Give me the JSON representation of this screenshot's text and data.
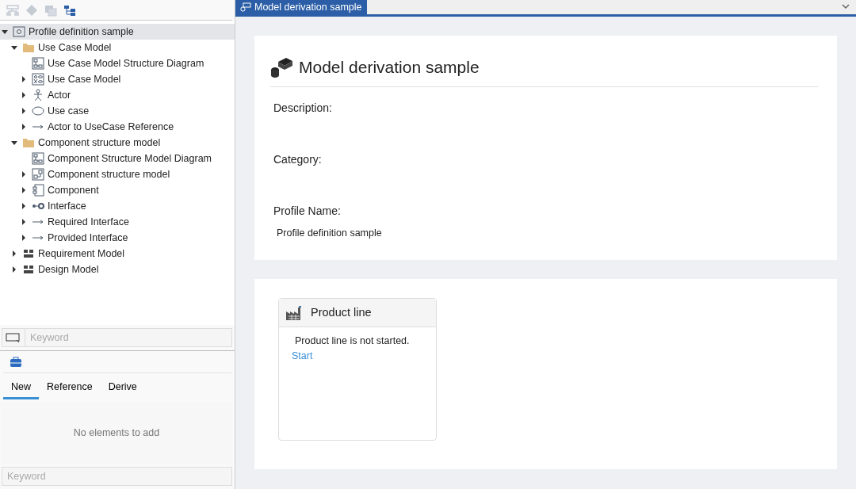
{
  "tree": [
    {
      "label": "Profile definition sample",
      "kind": "profile",
      "expanded": true,
      "selected": true,
      "children": [
        {
          "label": "Use Case Model",
          "kind": "folder",
          "expanded": true,
          "selected": false,
          "children": [
            {
              "label": "Use Case Model Structure Diagram",
              "kind": "diagram",
              "selected": false
            },
            {
              "label": "Use Case Model",
              "kind": "usecase-model",
              "expanded": false,
              "selected": false
            },
            {
              "label": "Actor",
              "kind": "actor",
              "expanded": false,
              "selected": false
            },
            {
              "label": "Use case",
              "kind": "ellipse",
              "expanded": false,
              "selected": false
            },
            {
              "label": "Actor to UseCase Reference",
              "kind": "arrow",
              "expanded": false,
              "selected": false
            }
          ]
        },
        {
          "label": "Component structure model",
          "kind": "folder",
          "expanded": true,
          "selected": false,
          "children": [
            {
              "label": "Component Structure Model Diagram",
              "kind": "diagram",
              "selected": false
            },
            {
              "label": "Component structure model",
              "kind": "component-model",
              "expanded": false,
              "selected": false
            },
            {
              "label": "Component",
              "kind": "component",
              "expanded": false,
              "selected": false
            },
            {
              "label": "Interface",
              "kind": "interface",
              "expanded": false,
              "selected": false
            },
            {
              "label": "Required Interface",
              "kind": "arrow",
              "expanded": false,
              "selected": false
            },
            {
              "label": "Provided Interface",
              "kind": "arrow",
              "expanded": false,
              "selected": false
            }
          ]
        },
        {
          "label": "Requirement Model",
          "kind": "package",
          "expanded": false,
          "selected": false
        },
        {
          "label": "Design Model",
          "kind": "package",
          "expanded": false,
          "selected": false
        }
      ]
    }
  ],
  "tree_search": {
    "placeholder": "Keyword"
  },
  "toolbox": {
    "tabs": [
      {
        "label": "New",
        "selected": true
      },
      {
        "label": "Reference",
        "selected": false
      },
      {
        "label": "Derive",
        "selected": false
      }
    ],
    "empty_text": "No elements to add",
    "search": {
      "placeholder": "Keyword"
    }
  },
  "editor_tab": {
    "label": "Model derivation sample"
  },
  "header": {
    "title": "Model derivation sample"
  },
  "fields": [
    {
      "label": "Description:"
    },
    {
      "label": "Category:"
    },
    {
      "label": "Profile Name:",
      "value": "Profile definition sample"
    }
  ],
  "product_line": {
    "title": "Product line",
    "status": "Product line is not started.",
    "link": "Start"
  }
}
